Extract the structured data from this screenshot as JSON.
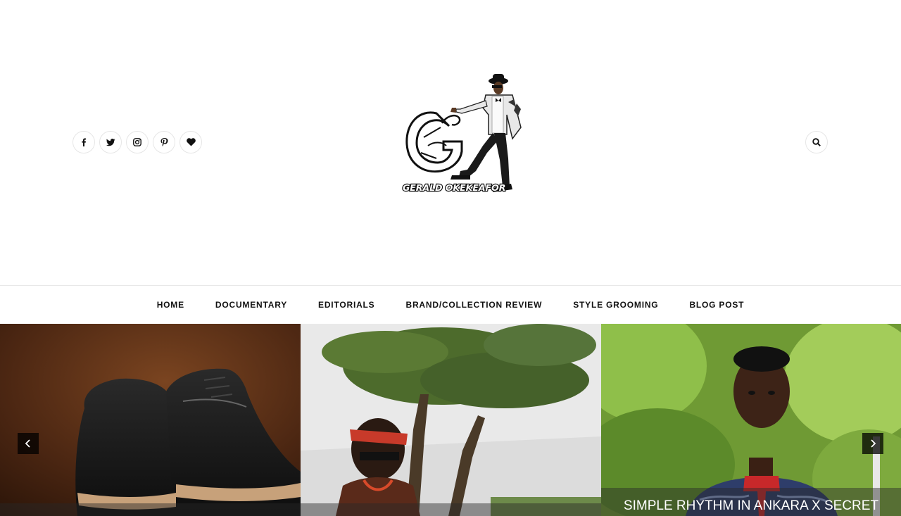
{
  "header": {
    "logo_text": "GERALD OKEKEAFOR",
    "social_icons": [
      "facebook-icon",
      "twitter-icon",
      "instagram-icon",
      "pinterest-icon",
      "heart-icon"
    ],
    "search_icon": "search-icon"
  },
  "nav": {
    "items": [
      {
        "label": "HOME"
      },
      {
        "label": "DOCUMENTARY"
      },
      {
        "label": "EDITORIALS"
      },
      {
        "label": "BRAND/COLLECTION REVIEW"
      },
      {
        "label": "STYLE GROOMING"
      },
      {
        "label": "BLOG POST"
      }
    ]
  },
  "slider": {
    "slides": [
      {
        "caption": ""
      },
      {
        "caption": ""
      },
      {
        "caption": "SIMPLE RHYTHM IN ANKARA X SECRET"
      }
    ],
    "prev_icon": "chevron-left-icon",
    "next_icon": "chevron-right-icon"
  }
}
